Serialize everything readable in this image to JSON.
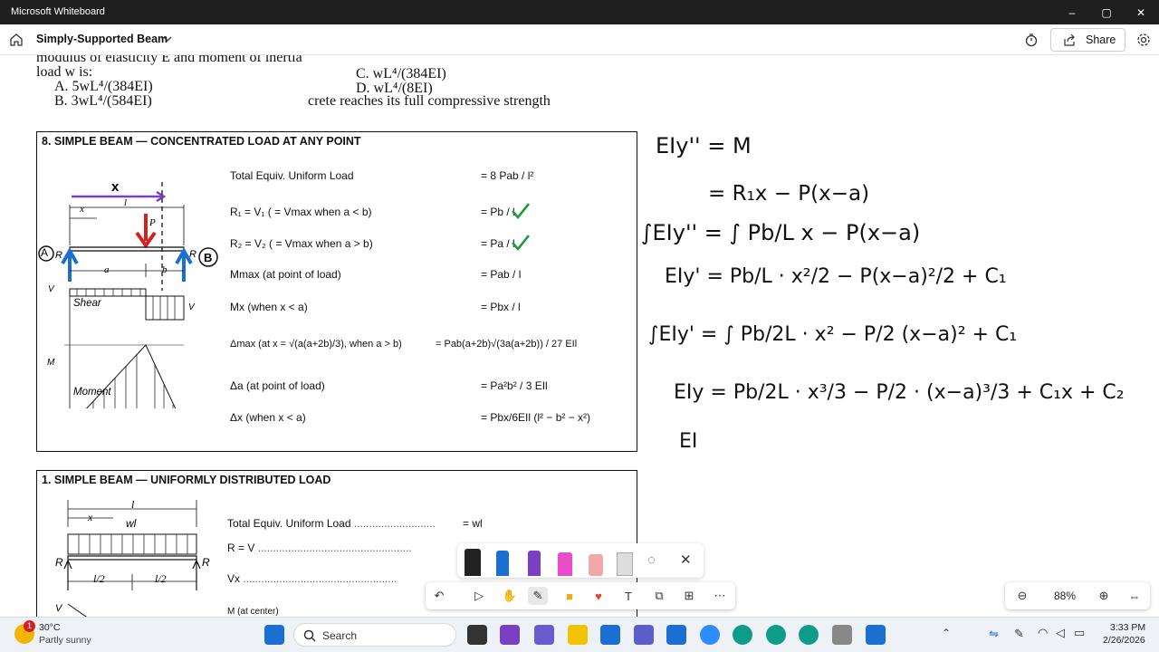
{
  "window": {
    "title": "Microsoft Whiteboard",
    "minimize": "–",
    "maximize": "▢",
    "close": "✕"
  },
  "appbar": {
    "board_name": "Simply-Supported Beam",
    "share_label": "Share"
  },
  "question": {
    "line1": "modulus of elasticity E and moment of inertia",
    "line2": "load w is:",
    "optA": "A.  5wL⁴/(384EI)",
    "optB": "B.  3wL⁴/(584EI)",
    "optC": "C.  wL⁴/(384EI)",
    "optD": "D.  wL⁴/(8EI)",
    "fragment": "crete reaches its full compressive strength"
  },
  "table8": {
    "title": "8. SIMPLE BEAM — CONCENTRATED LOAD AT ANY POINT",
    "rows": [
      {
        "label": "Total Equiv. Uniform Load",
        "result": "= 8 Pab / l²"
      },
      {
        "label": "R₁ = V₁ ( = Vmax when a < b)",
        "result": "= Pb / l"
      },
      {
        "label": "R₂ = V₂ ( = Vmax when a > b)",
        "result": "= Pa / l"
      },
      {
        "label": "Mmax  (at point of load)",
        "result": "= Pab / l"
      },
      {
        "label": "Mx     (when x < a)",
        "result": "= Pbx / l"
      },
      {
        "label": "Δmax   (at x = √(a(a+2b)/3), when a > b)",
        "result": "= Pab(a+2b)√(3a(a+2b)) / 27 EIl"
      },
      {
        "label": "Δa     (at point of load)",
        "result": "= Pa²b² / 3 EIl"
      },
      {
        "label": "Δx     (when x < a)",
        "result": "= Pbx/6EIl (l² − b² − x²)"
      }
    ],
    "diagram": {
      "x_top": "x",
      "l": "l",
      "x_small": "x",
      "P": "P",
      "R1": "R",
      "R2": "R",
      "a": "a",
      "b": "b",
      "V1": "V",
      "V2": "V",
      "shear": "Shear",
      "Mmax": "M",
      "moment": "Moment",
      "circleA": "A",
      "circleB": "B"
    }
  },
  "table1": {
    "title": "1. SIMPLE BEAM — UNIFORMLY DISTRIBUTED LOAD",
    "rows": [
      {
        "label": "Total Equiv. Uniform Load",
        "result": "= wl"
      },
      {
        "label": "R = V",
        "result": ""
      },
      {
        "label": "Vx",
        "result": ""
      },
      {
        "label": "M       (at center)",
        "result": ""
      }
    ],
    "diagram": {
      "l": "l",
      "x": "x",
      "wl": "wl",
      "R1": "R",
      "R2": "R",
      "half1": "l/2",
      "half2": "l/2",
      "V": "V"
    }
  },
  "notes": {
    "l1": "EIy'' = M",
    "l2": "= R₁x − P(x−a)",
    "l3": "∫EIy'' = ∫ Pb/L x − P(x−a)",
    "l4": "EIy' = Pb/L · x²/2 − P(x−a)²/2 + C₁",
    "l5": "∫EIy' = ∫ Pb/2L · x² − P/2 (x−a)² + C₁",
    "l6": "EIy = Pb/2L · x³/3 − P/2 · (x−a)³/3 + C₁x + C₂",
    "l7": "EI"
  },
  "zoom": {
    "level": "88%"
  },
  "taskbar": {
    "weather_temp": "30°C",
    "weather_desc": "Partly sunny",
    "search_placeholder": "Search",
    "time": "3:33 PM",
    "date": "2/26/2026",
    "badge": "1"
  },
  "colors": {
    "accent_blue": "#1a6fd1",
    "load_red": "#d62020",
    "check_green": "#1c9a3a",
    "axis_purple": "#7b3fc4"
  }
}
